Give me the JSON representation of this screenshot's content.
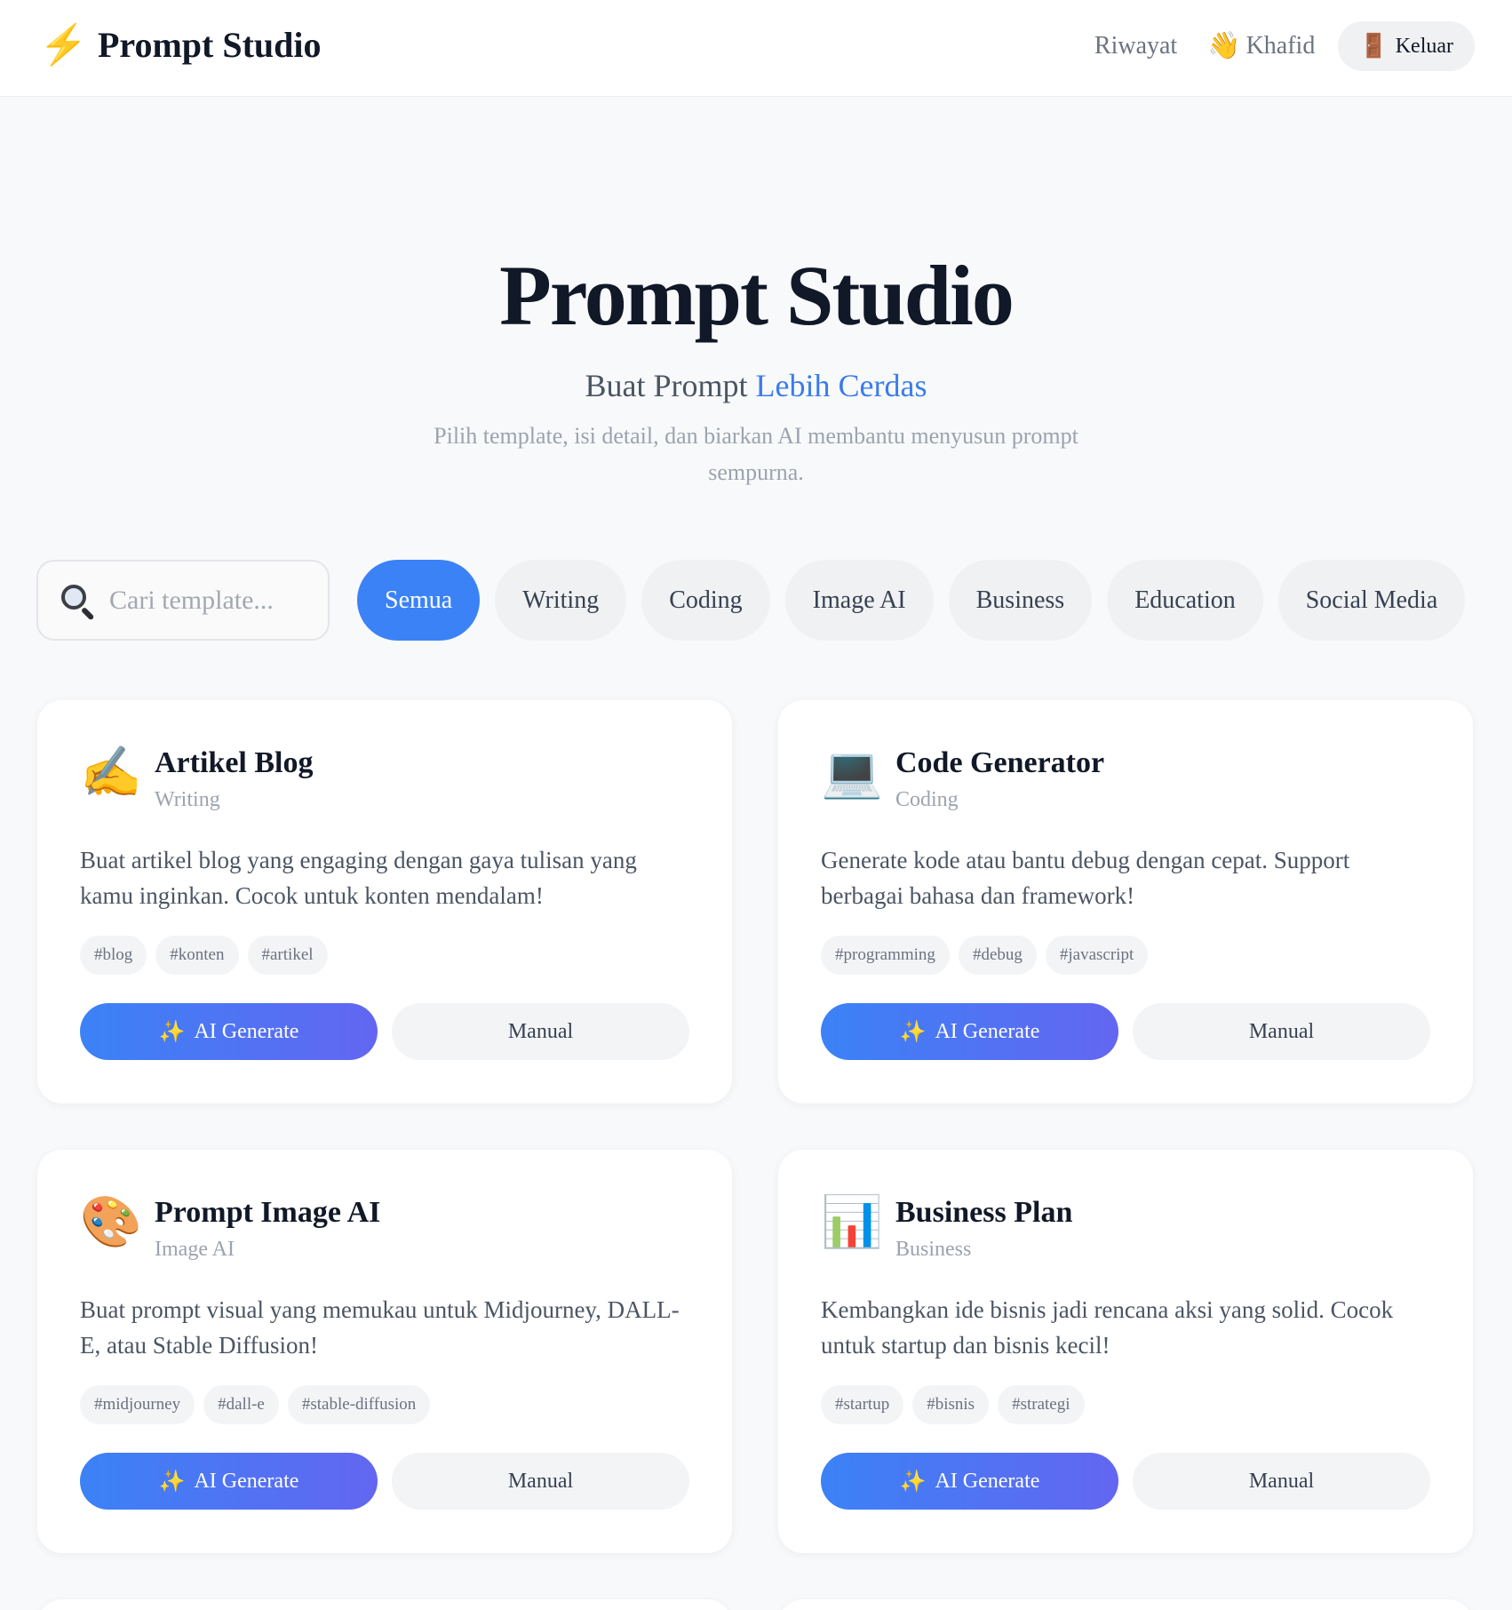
{
  "navbar": {
    "brand_icon": "⚡",
    "brand_name": "Prompt Studio",
    "history_link": "Riwayat",
    "user_emoji": "👋",
    "user_name": "Khafid",
    "logout_emoji": "🚪",
    "logout_label": "Keluar"
  },
  "hero": {
    "title": "Prompt Studio",
    "subtitle_prefix": "Buat Prompt",
    "subtitle_highlight": "Lebih Cerdas",
    "description": "Pilih template, isi detail, dan biarkan AI membantu menyusun prompt sempurna."
  },
  "search": {
    "placeholder": "Cari template..."
  },
  "filters": [
    {
      "label": "Semua",
      "active": true
    },
    {
      "label": "Writing",
      "active": false
    },
    {
      "label": "Coding",
      "active": false
    },
    {
      "label": "Image AI",
      "active": false
    },
    {
      "label": "Business",
      "active": false
    },
    {
      "label": "Education",
      "active": false
    },
    {
      "label": "Social Media",
      "active": false
    }
  ],
  "cards": [
    {
      "icon": "✍️",
      "title": "Artikel Blog",
      "category": "Writing",
      "description": "Buat artikel blog yang engaging dengan gaya tulisan yang kamu inginkan. Cocok untuk konten mendalam!",
      "tags": [
        "#blog",
        "#konten",
        "#artikel"
      ],
      "ai_label": "AI Generate",
      "manual_label": "Manual"
    },
    {
      "icon": "💻",
      "title": "Code Generator",
      "category": "Coding",
      "description": "Generate kode atau bantu debug dengan cepat. Support berbagai bahasa dan framework!",
      "tags": [
        "#programming",
        "#debug",
        "#javascript"
      ],
      "ai_label": "AI Generate",
      "manual_label": "Manual"
    },
    {
      "icon": "🎨",
      "title": "Prompt Image AI",
      "category": "Image AI",
      "description": "Buat prompt visual yang memukau untuk Midjourney, DALL-E, atau Stable Diffusion!",
      "tags": [
        "#midjourney",
        "#dall-e",
        "#stable-diffusion"
      ],
      "ai_label": "AI Generate",
      "manual_label": "Manual"
    },
    {
      "icon": "📊",
      "title": "Business Plan",
      "category": "Business",
      "description": "Kembangkan ide bisnis jadi rencana aksi yang solid. Cocok untuk startup dan bisnis kecil!",
      "tags": [
        "#startup",
        "#bisnis",
        "#strategi"
      ],
      "ai_label": "AI Generate",
      "manual_label": "Manual"
    }
  ],
  "ai_button_emoji": "✨",
  "colors": {
    "accent": "#3b82f6",
    "accent_gradient_end": "#6366f1",
    "highlight_text": "#3b7ced",
    "brand_bolt": "#f6b21b",
    "page_bg": "#f8f9fa"
  }
}
